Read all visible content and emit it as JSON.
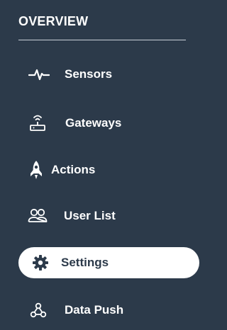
{
  "sidebar": {
    "section_title": "OVERVIEW",
    "items": [
      {
        "label": "Sensors",
        "icon": "activity-pulse-icon",
        "active": false
      },
      {
        "label": "Gateways",
        "icon": "router-wifi-icon",
        "active": false
      },
      {
        "label": "Actions",
        "icon": "rocket-icon",
        "active": false
      },
      {
        "label": "User List",
        "icon": "users-icon",
        "active": false
      },
      {
        "label": "Settings",
        "icon": "gear-icon",
        "active": true
      },
      {
        "label": "Data Push",
        "icon": "webhook-icon",
        "active": false
      }
    ]
  },
  "colors": {
    "background": "#2c3a4a",
    "text": "#ffffff",
    "active_background": "#ffffff",
    "active_text": "#2c3a4a",
    "divider": "#c9d0d8"
  }
}
